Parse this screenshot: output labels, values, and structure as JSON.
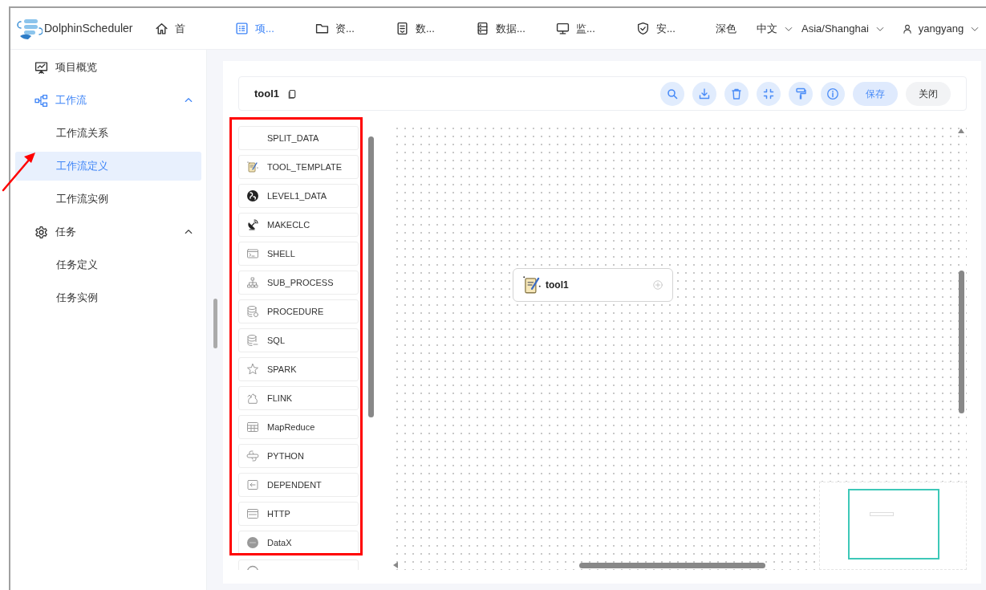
{
  "header": {
    "logo_text": "DolphinScheduler",
    "nav": [
      {
        "label": "首",
        "selected": false
      },
      {
        "label": "项...",
        "selected": true
      },
      {
        "label": "资...",
        "selected": false
      },
      {
        "label": "数...",
        "selected": false
      },
      {
        "label": "数据...",
        "selected": false
      },
      {
        "label": "监...",
        "selected": false
      },
      {
        "label": "安...",
        "selected": false
      }
    ],
    "theme": "深色",
    "language": "中文",
    "timezone": "Asia/Shanghai",
    "user": "yangyang"
  },
  "sidebar": {
    "items": [
      {
        "label": "项目概览",
        "selected": false
      },
      {
        "label": "工作流",
        "expanded": true,
        "children": [
          {
            "label": "工作流关系",
            "selected": false
          },
          {
            "label": "工作流定义",
            "selected": true
          },
          {
            "label": "工作流实例",
            "selected": false
          }
        ]
      },
      {
        "label": "任务",
        "expanded": true,
        "children": [
          {
            "label": "任务定义",
            "selected": false
          },
          {
            "label": "任务实例",
            "selected": false
          }
        ]
      }
    ]
  },
  "toolbar": {
    "title": "tool1",
    "buttons": [
      "保存",
      "关闭"
    ]
  },
  "tasks": [
    "SPLIT_DATA",
    "TOOL_TEMPLATE",
    "LEVEL1_DATA",
    "MAKECLC",
    "SHELL",
    "SUB_PROCESS",
    "PROCEDURE",
    "SQL",
    "SPARK",
    "FLINK",
    "MapReduce",
    "PYTHON",
    "DEPENDENT",
    "HTTP",
    "DataX"
  ],
  "canvas": {
    "nodes": [
      {
        "label": "tool1"
      }
    ]
  }
}
